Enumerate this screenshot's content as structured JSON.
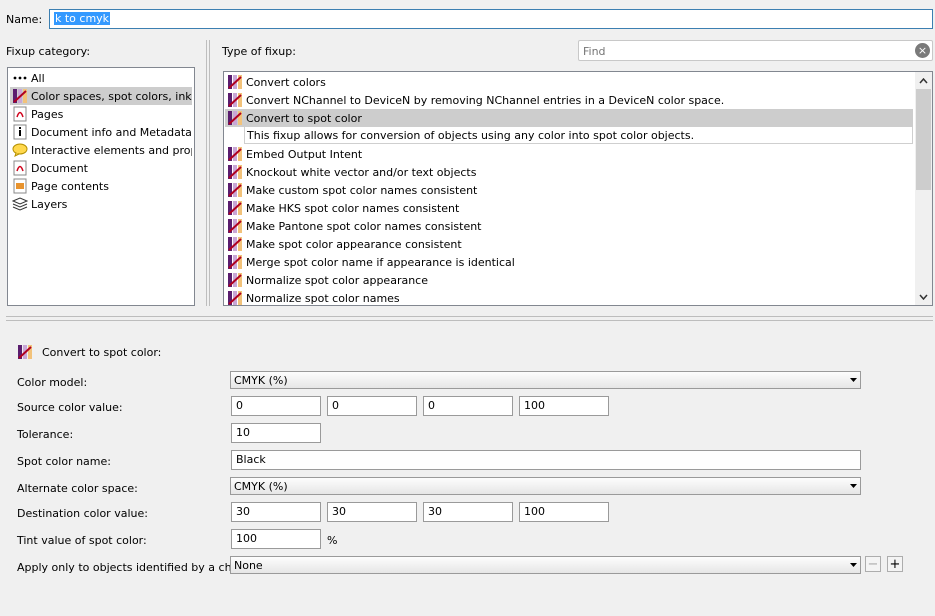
{
  "name": {
    "label": "Name:",
    "value": "k to cmyk"
  },
  "category": {
    "label": "Fixup category:",
    "items": [
      {
        "label": "All",
        "icon": "dots-icon"
      },
      {
        "label": "Color spaces, spot colors, inks",
        "icon": "color-fixup-icon"
      },
      {
        "label": "Pages",
        "icon": "pdf-page-icon"
      },
      {
        "label": "Document info and Metadata",
        "icon": "info-icon"
      },
      {
        "label": "Interactive elements and propertie",
        "icon": "comment-icon"
      },
      {
        "label": "Document",
        "icon": "pdf-document-icon"
      },
      {
        "label": "Page contents",
        "icon": "page-contents-icon"
      },
      {
        "label": "Layers",
        "icon": "layers-icon"
      }
    ]
  },
  "fixup": {
    "label": "Type of fixup:",
    "find_placeholder": "Find",
    "items": [
      "Convert colors",
      "Convert NChannel to DeviceN by removing NChannel entries in a DeviceN color space.",
      "Convert to spot color",
      "Embed Output Intent",
      "Knockout white vector and/or text objects",
      "Make custom spot color names consistent",
      "Make HKS spot color names consistent",
      "Make Pantone spot color names consistent",
      "Make spot color appearance consistent",
      "Merge spot color name if appearance is identical",
      "Normalize spot color appearance",
      "Normalize spot color names"
    ],
    "selected_description": "This fixup allows for conversion of objects using any color into spot color objects."
  },
  "form": {
    "title": "Convert to spot color:",
    "color_model_label": "Color model:",
    "color_model_value": "CMYK (%)",
    "source_label": "Source color value:",
    "source_values": [
      "0",
      "0",
      "0",
      "100"
    ],
    "tolerance_label": "Tolerance:",
    "tolerance_value": "10",
    "spot_name_label": "Spot color name:",
    "spot_name_value": "Black",
    "alt_space_label": "Alternate color space:",
    "alt_space_value": "CMYK (%)",
    "dest_label": "Destination color value:",
    "dest_values": [
      "30",
      "30",
      "30",
      "100"
    ],
    "tint_label": "Tint value of spot color:",
    "tint_value": "100",
    "tint_unit": "%",
    "apply_label": "Apply only to objects identified by a check:",
    "apply_value": "None",
    "minus_label": "−",
    "plus_label": "+"
  },
  "colors": {
    "selection": "#cdcdcd",
    "focus_border": "#3c7fb1",
    "highlight": "#3399ff"
  }
}
